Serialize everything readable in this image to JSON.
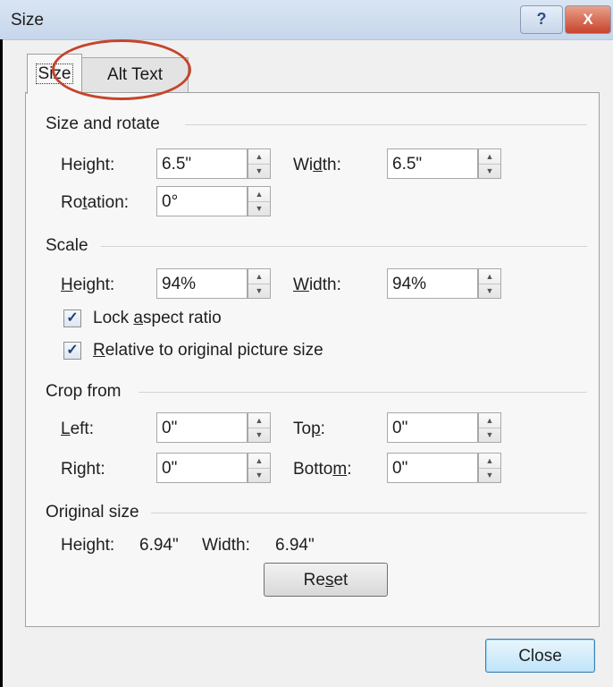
{
  "window": {
    "title": "Size",
    "help_label": "?",
    "close_label": "X"
  },
  "tabs": [
    {
      "label": "Size",
      "selected": true
    },
    {
      "label": "Alt Text",
      "selected": false
    }
  ],
  "size_and_rotate": {
    "group_label": "Size and rotate",
    "height": {
      "pre": "Hei",
      "acc": "g",
      "post": "ht:",
      "value": "6.5\""
    },
    "width": {
      "pre": "Wi",
      "acc": "d",
      "post": "th:",
      "value": "6.5\""
    },
    "rotation": {
      "pre": "Ro",
      "acc": "t",
      "post": "ation:",
      "value": "0°"
    }
  },
  "scale": {
    "group_label": "Scale",
    "height": {
      "pre": "",
      "acc": "H",
      "post": "eight:",
      "value": "94%"
    },
    "width": {
      "pre": "",
      "acc": "W",
      "post": "idth:",
      "value": "94%"
    },
    "lock_aspect": {
      "pre": "Lock ",
      "acc": "a",
      "post": "spect ratio",
      "checked": true
    },
    "relative": {
      "pre": "",
      "acc": "R",
      "post": "elative to original picture size",
      "checked": true
    }
  },
  "crop": {
    "group_label": "Crop from",
    "left": {
      "pre": "",
      "acc": "L",
      "post": "eft:",
      "value": "0\""
    },
    "top": {
      "pre": "To",
      "acc": "p",
      "post": ":",
      "value": "0\""
    },
    "right": {
      "pre": "Ri",
      "acc": "g",
      "post": "ht:",
      "value": "0\""
    },
    "bottom": {
      "pre": "Botto",
      "acc": "m",
      "post": ":",
      "value": "0\""
    }
  },
  "original_size": {
    "group_label": "Original size",
    "height_label": "Height:",
    "height_value": "6.94\"",
    "width_label": "Width:",
    "width_value": "6.94\""
  },
  "buttons": {
    "reset": {
      "pre": "Re",
      "acc": "s",
      "post": "et"
    },
    "close": "Close"
  },
  "colors": {
    "highlight_ellipse": "#c4452c",
    "title_bar": "#c6d6ea",
    "close_button_border": "#3c7fb1"
  }
}
